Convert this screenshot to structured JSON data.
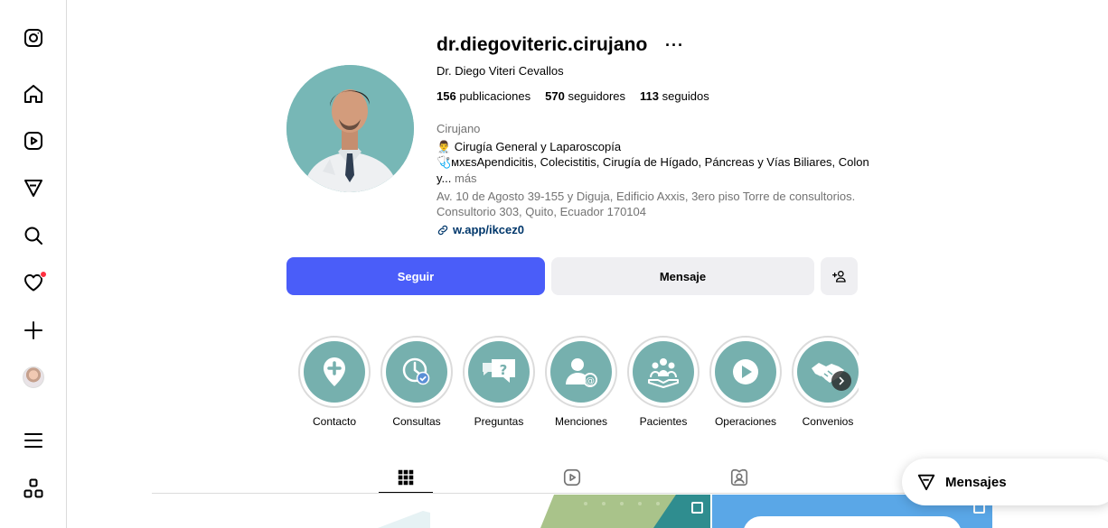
{
  "nav": {
    "items": [
      {
        "name": "instagram-logo-icon"
      },
      {
        "name": "home-icon"
      },
      {
        "name": "reels-icon"
      },
      {
        "name": "explore-icon"
      },
      {
        "name": "search-icon"
      },
      {
        "name": "notifications-heart-icon",
        "badge": true
      },
      {
        "name": "create-plus-icon"
      },
      {
        "name": "profile-avatar"
      },
      {
        "name": "menu-hamburger-icon"
      },
      {
        "name": "more-apps-icon"
      }
    ]
  },
  "profile": {
    "username": "dr.diegoviteric.cirujano",
    "options": "···",
    "full_name": "Dr. Diego Viteri Cevallos",
    "stats": {
      "posts_count": "156",
      "posts_label": "publicaciones",
      "followers_count": "570",
      "followers_label": "seguidores",
      "following_count": "113",
      "following_label": "seguidos"
    },
    "category": "Cirujano",
    "bio_line1": "👨‍⚕️ Cirugía General y Laparoscopía",
    "bio_line2": "🩺ᴍxᴇsApendicitis, Colecistitis, Cirugía de Hígado, Páncreas y Vías Biliares, Colon",
    "bio_line3": "y...",
    "more_label": "más",
    "address": "Av. 10 de Agosto 39-155 y Diguja, Edificio Axxis, 3ero piso Torre de consultorios. Consultorio 303, Quito, Ecuador 170104",
    "link": "w.app/ikcez0"
  },
  "actions": {
    "follow_label": "Seguir",
    "message_label": "Mensaje"
  },
  "highlights": [
    {
      "label": "Contacto",
      "icon": "map-pin-plus-icon"
    },
    {
      "label": "Consultas",
      "icon": "clock-check-icon"
    },
    {
      "label": "Preguntas",
      "icon": "chat-question-icon"
    },
    {
      "label": "Menciones",
      "icon": "user-at-icon"
    },
    {
      "label": "Pacientes",
      "icon": "people-hand-icon"
    },
    {
      "label": "Operaciones",
      "icon": "play-circle-icon"
    },
    {
      "label": "Convenios",
      "icon": "handshake-icon"
    }
  ],
  "tabs": [
    {
      "name": "posts-grid-icon",
      "active": true
    },
    {
      "name": "reels-tab-icon",
      "active": false
    },
    {
      "name": "tagged-tab-icon",
      "active": false
    }
  ],
  "messages_pill": {
    "label": "Mensajes"
  },
  "colors": {
    "follow_button": "#4a5df9",
    "secondary_button": "#efeff2",
    "highlight_teal": "#76b0ae",
    "link": "#00376b",
    "notification_dot": "#ff3040"
  }
}
